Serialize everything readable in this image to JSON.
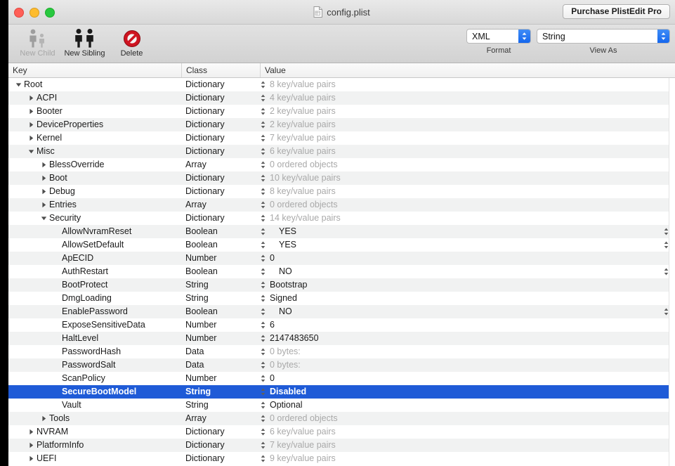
{
  "window": {
    "title": "config.plist",
    "title_icon": "plist-document-icon",
    "traffic_lights": [
      "close-button",
      "minimize-button",
      "zoom-button"
    ],
    "purchase_label": "Purchase PlistEdit Pro"
  },
  "toolbar": {
    "items": [
      {
        "label": "New Child",
        "icon": "two-people-icon",
        "enabled": false
      },
      {
        "label": "New Sibling",
        "icon": "two-people-icon",
        "enabled": true
      },
      {
        "label": "Delete",
        "icon": "prohibition-icon",
        "enabled": true
      }
    ],
    "format": {
      "value": "XML",
      "caption": "Format"
    },
    "view_as": {
      "value": "String",
      "caption": "View As"
    }
  },
  "outline": {
    "columns": [
      "Key",
      "Class",
      "Value"
    ],
    "selected_index": 23,
    "rows": [
      {
        "key": "Root",
        "level": 0,
        "twisty": "open",
        "class": "Dictionary",
        "value": "8 key/value pairs",
        "muted": true,
        "bool": false
      },
      {
        "key": "ACPI",
        "level": 1,
        "twisty": "closed",
        "class": "Dictionary",
        "value": "4 key/value pairs",
        "muted": true,
        "bool": false
      },
      {
        "key": "Booter",
        "level": 1,
        "twisty": "closed",
        "class": "Dictionary",
        "value": "2 key/value pairs",
        "muted": true,
        "bool": false
      },
      {
        "key": "DeviceProperties",
        "level": 1,
        "twisty": "closed",
        "class": "Dictionary",
        "value": "2 key/value pairs",
        "muted": true,
        "bool": false
      },
      {
        "key": "Kernel",
        "level": 1,
        "twisty": "closed",
        "class": "Dictionary",
        "value": "7 key/value pairs",
        "muted": true,
        "bool": false
      },
      {
        "key": "Misc",
        "level": 1,
        "twisty": "open",
        "class": "Dictionary",
        "value": "6 key/value pairs",
        "muted": true,
        "bool": false
      },
      {
        "key": "BlessOverride",
        "level": 2,
        "twisty": "closed",
        "class": "Array",
        "value": "0 ordered objects",
        "muted": true,
        "bool": false
      },
      {
        "key": "Boot",
        "level": 2,
        "twisty": "closed",
        "class": "Dictionary",
        "value": "10 key/value pairs",
        "muted": true,
        "bool": false
      },
      {
        "key": "Debug",
        "level": 2,
        "twisty": "closed",
        "class": "Dictionary",
        "value": "8 key/value pairs",
        "muted": true,
        "bool": false
      },
      {
        "key": "Entries",
        "level": 2,
        "twisty": "closed",
        "class": "Array",
        "value": "0 ordered objects",
        "muted": true,
        "bool": false
      },
      {
        "key": "Security",
        "level": 2,
        "twisty": "open",
        "class": "Dictionary",
        "value": "14 key/value pairs",
        "muted": true,
        "bool": false
      },
      {
        "key": "AllowNvramReset",
        "level": 3,
        "twisty": "none",
        "class": "Boolean",
        "value": "YES",
        "muted": false,
        "bool": true
      },
      {
        "key": "AllowSetDefault",
        "level": 3,
        "twisty": "none",
        "class": "Boolean",
        "value": "YES",
        "muted": false,
        "bool": true
      },
      {
        "key": "ApECID",
        "level": 3,
        "twisty": "none",
        "class": "Number",
        "value": "0",
        "muted": false,
        "bool": false
      },
      {
        "key": "AuthRestart",
        "level": 3,
        "twisty": "none",
        "class": "Boolean",
        "value": "NO",
        "muted": false,
        "bool": true
      },
      {
        "key": "BootProtect",
        "level": 3,
        "twisty": "none",
        "class": "String",
        "value": "Bootstrap",
        "muted": false,
        "bool": false
      },
      {
        "key": "DmgLoading",
        "level": 3,
        "twisty": "none",
        "class": "String",
        "value": "Signed",
        "muted": false,
        "bool": false
      },
      {
        "key": "EnablePassword",
        "level": 3,
        "twisty": "none",
        "class": "Boolean",
        "value": "NO",
        "muted": false,
        "bool": true
      },
      {
        "key": "ExposeSensitiveData",
        "level": 3,
        "twisty": "none",
        "class": "Number",
        "value": "6",
        "muted": false,
        "bool": false
      },
      {
        "key": "HaltLevel",
        "level": 3,
        "twisty": "none",
        "class": "Number",
        "value": "2147483650",
        "muted": false,
        "bool": false
      },
      {
        "key": "PasswordHash",
        "level": 3,
        "twisty": "none",
        "class": "Data",
        "value": "0 bytes:",
        "muted": true,
        "bool": false
      },
      {
        "key": "PasswordSalt",
        "level": 3,
        "twisty": "none",
        "class": "Data",
        "value": "0 bytes:",
        "muted": true,
        "bool": false
      },
      {
        "key": "ScanPolicy",
        "level": 3,
        "twisty": "none",
        "class": "Number",
        "value": "0",
        "muted": false,
        "bool": false
      },
      {
        "key": "SecureBootModel",
        "level": 3,
        "twisty": "none",
        "class": "String",
        "value": "Disabled",
        "muted": false,
        "bool": false
      },
      {
        "key": "Vault",
        "level": 3,
        "twisty": "none",
        "class": "String",
        "value": "Optional",
        "muted": false,
        "bool": false
      },
      {
        "key": "Tools",
        "level": 2,
        "twisty": "closed",
        "class": "Array",
        "value": "0 ordered objects",
        "muted": true,
        "bool": false
      },
      {
        "key": "NVRAM",
        "level": 1,
        "twisty": "closed",
        "class": "Dictionary",
        "value": "6 key/value pairs",
        "muted": true,
        "bool": false
      },
      {
        "key": "PlatformInfo",
        "level": 1,
        "twisty": "closed",
        "class": "Dictionary",
        "value": "7 key/value pairs",
        "muted": true,
        "bool": false
      },
      {
        "key": "UEFI",
        "level": 1,
        "twisty": "closed",
        "class": "Dictionary",
        "value": "9 key/value pairs",
        "muted": true,
        "bool": false
      }
    ]
  },
  "colors": {
    "selection": "#1f5bd7",
    "stripe": "#f1f2f2",
    "popup_arrow": "#1567ee",
    "muted_text": "#a9a9a9"
  }
}
